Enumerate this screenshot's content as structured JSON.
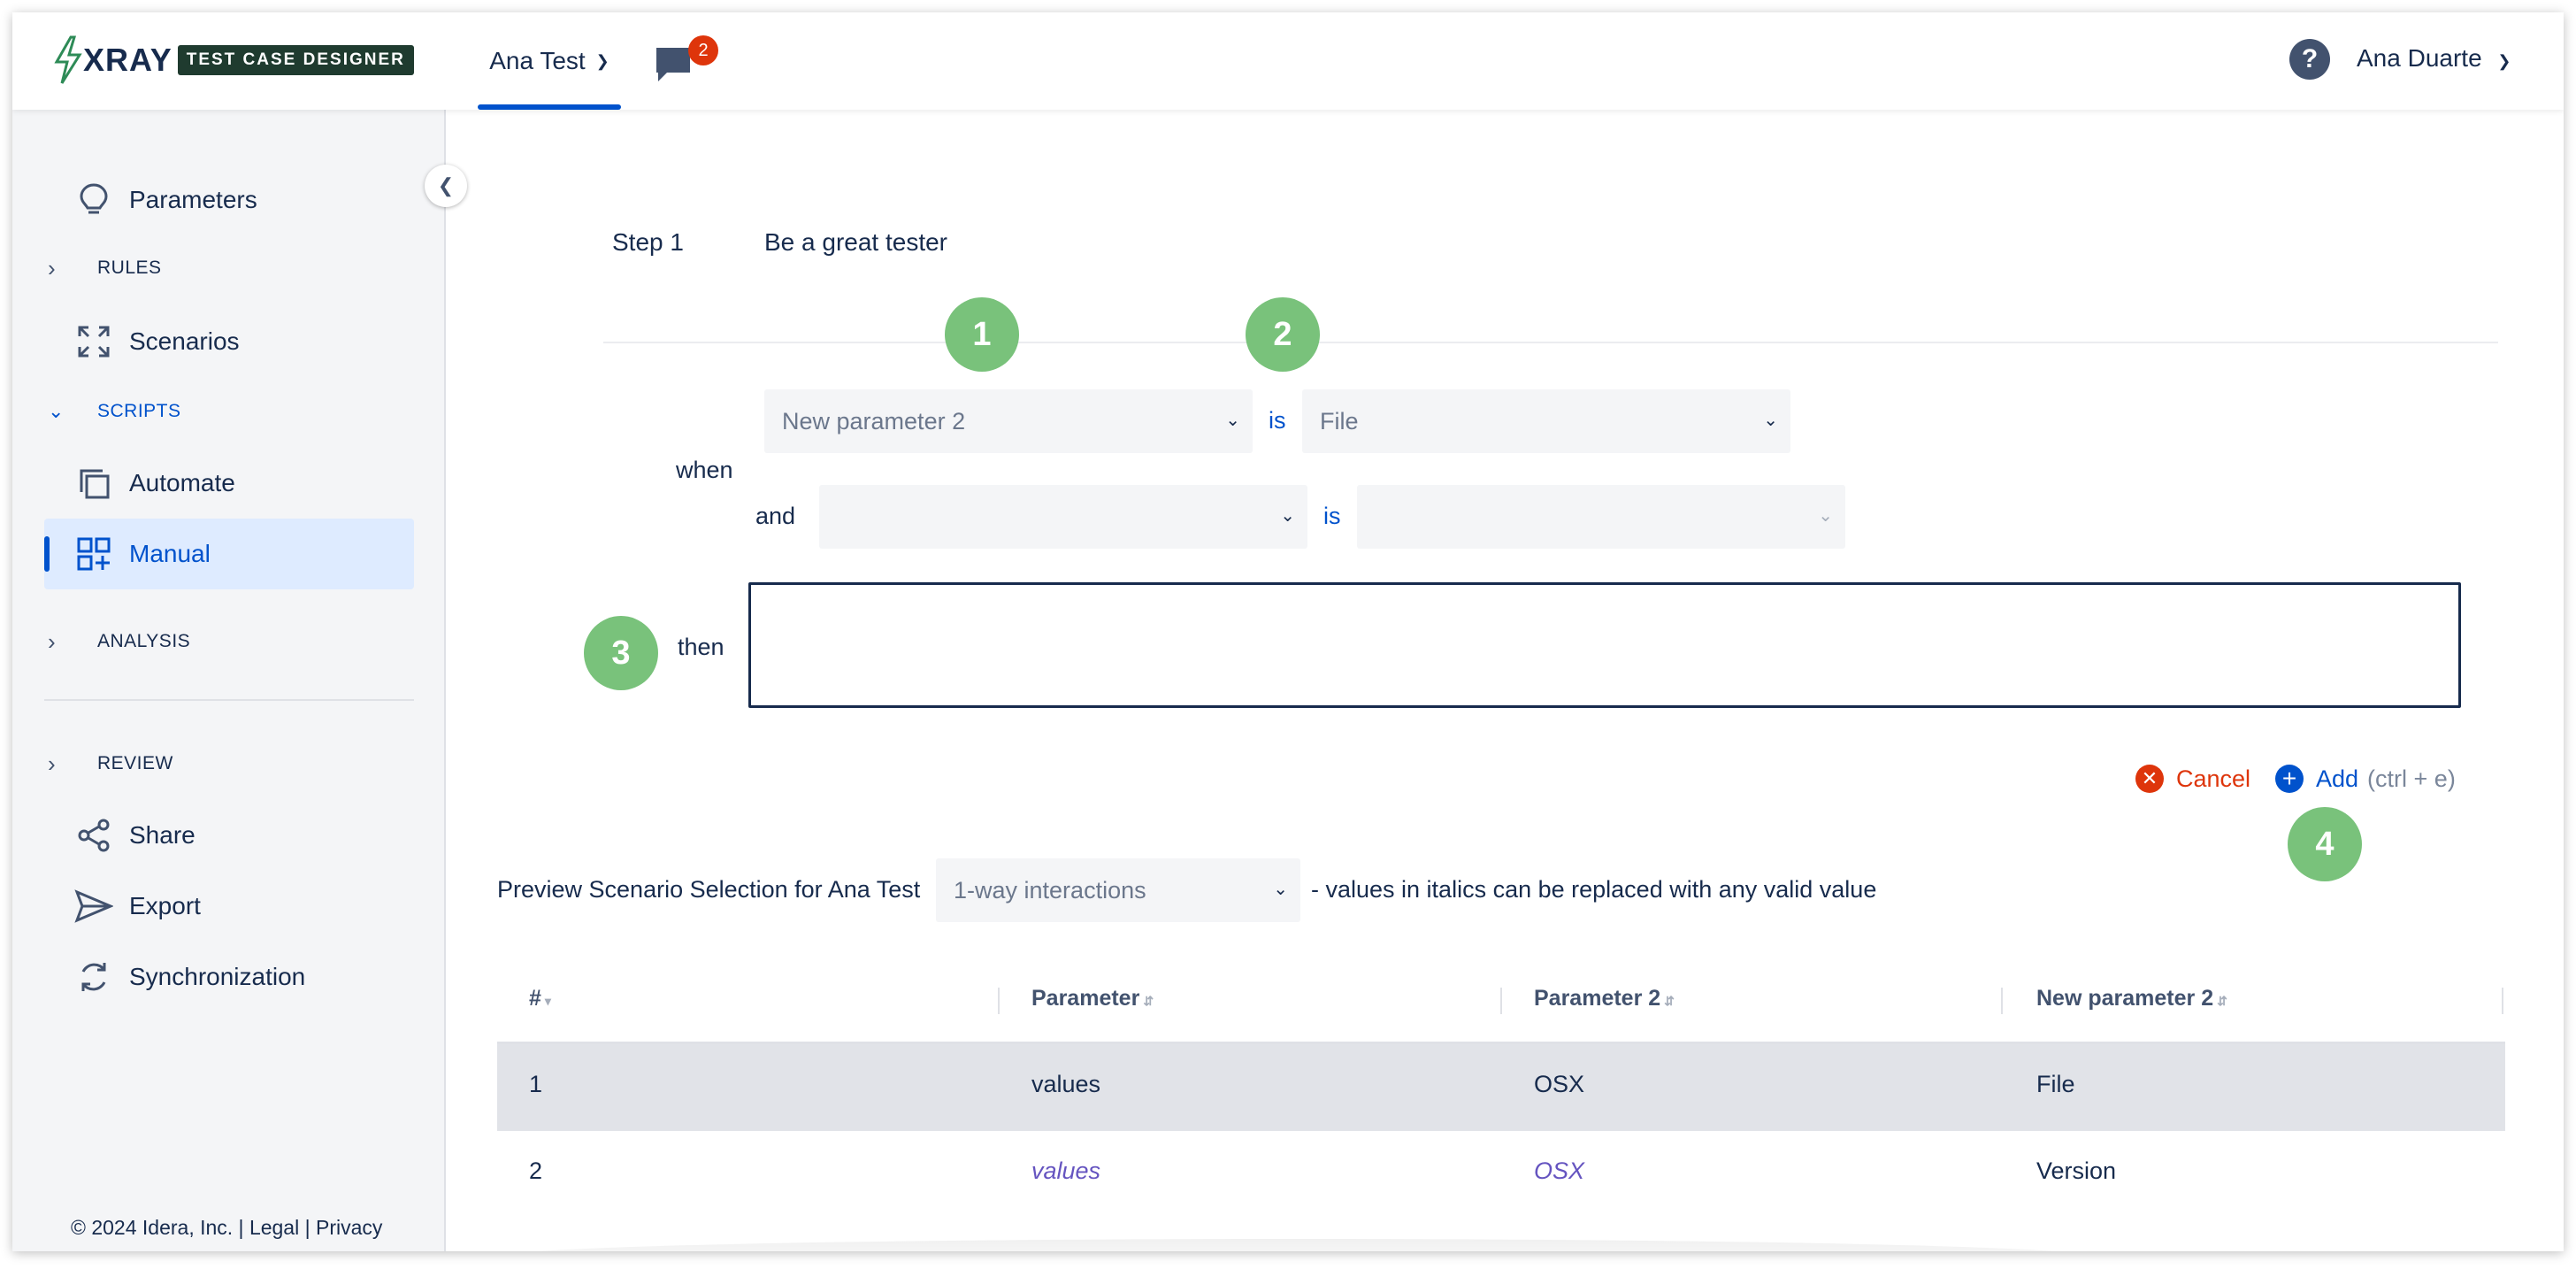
{
  "header": {
    "logo_text": "XRAY",
    "logo_badge": "TEST CASE DESIGNER",
    "project_tab": "Ana Test",
    "notification_count": "2",
    "help_label": "?",
    "user_name": "Ana Duarte"
  },
  "sidebar": {
    "parameters": "Parameters",
    "rules": "RULES",
    "scenarios": "Scenarios",
    "scripts": "SCRIPTS",
    "automate": "Automate",
    "manual": "Manual",
    "analysis": "ANALYSIS",
    "review": "REVIEW",
    "share": "Share",
    "export": "Export",
    "synchronization": "Synchronization",
    "footer_copyright": "© 2024 Idera, Inc. | ",
    "footer_legal": "Legal",
    "footer_sep": " | ",
    "footer_privacy": "Privacy"
  },
  "step": {
    "label": "Step 1",
    "description": "Be a great tester"
  },
  "condition": {
    "when_label": "when",
    "and_label": "and",
    "is_label_1": "is",
    "is_label_2": "is",
    "then_label": "then",
    "param_1_value": "New parameter 2",
    "value_1_value": "File",
    "param_2_value": "",
    "value_2_value": "",
    "then_value": ""
  },
  "markers": [
    "1",
    "2",
    "3",
    "4"
  ],
  "actions": {
    "cancel": "Cancel",
    "add": "Add",
    "add_hint": "(ctrl + e)"
  },
  "preview": {
    "label": "Preview Scenario Selection for Ana Test",
    "selected": "1-way interactions",
    "note": "- values in italics can be replaced with any valid value"
  },
  "table": {
    "headers": [
      "#",
      "Parameter",
      "Parameter 2",
      "New parameter 2"
    ],
    "rows": [
      [
        "1",
        "values",
        "OSX",
        "File"
      ],
      [
        "2",
        "values",
        "OSX",
        "Version"
      ]
    ]
  },
  "colors": {
    "accent": "#0052cc",
    "marker": "#79c27b",
    "cancel": "#de350b",
    "badge": "#de350b"
  }
}
